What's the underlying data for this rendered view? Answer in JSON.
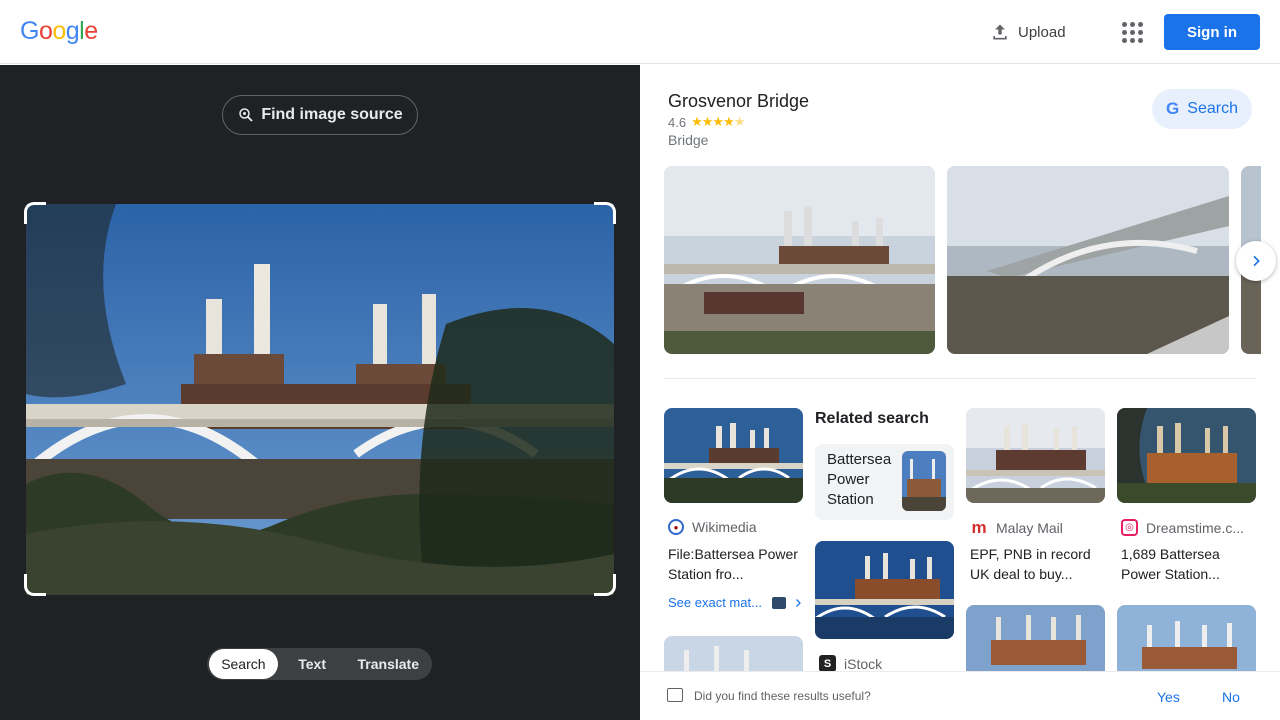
{
  "header": {
    "logo_letters": [
      "G",
      "o",
      "o",
      "g",
      "l",
      "e"
    ],
    "logo_colors": [
      "#4285F4",
      "#EA4335",
      "#FBBC05",
      "#4285F4",
      "#34A853",
      "#EA4335"
    ],
    "upload_label": "Upload",
    "signin_label": "Sign in"
  },
  "left": {
    "find_source_label": "Find image source",
    "modes": [
      "Search",
      "Text",
      "Translate"
    ],
    "active_mode": "Search"
  },
  "knowledge_panel": {
    "title": "Grosvenor Bridge",
    "rating": "4.6",
    "stars": "★★★★",
    "type": "Bridge",
    "search_label": "Search"
  },
  "results": {
    "wikimedia": {
      "source": "Wikimedia",
      "title": "File:Battersea Power Station fro...",
      "see_exact": "See exact mat..."
    },
    "related": {
      "heading": "Related search",
      "chip_label": "Battersea Power Station"
    },
    "malay": {
      "source": "Malay Mail",
      "title": "EPF, PNB in record UK deal to buy..."
    },
    "dreamstime": {
      "source": "Dreamstime.c...",
      "title": "1,689 Battersea Power Station..."
    },
    "istock": {
      "source": "iStock"
    }
  },
  "feedback": {
    "question": "Did you find these results useful?",
    "yes": "Yes",
    "no": "No"
  }
}
